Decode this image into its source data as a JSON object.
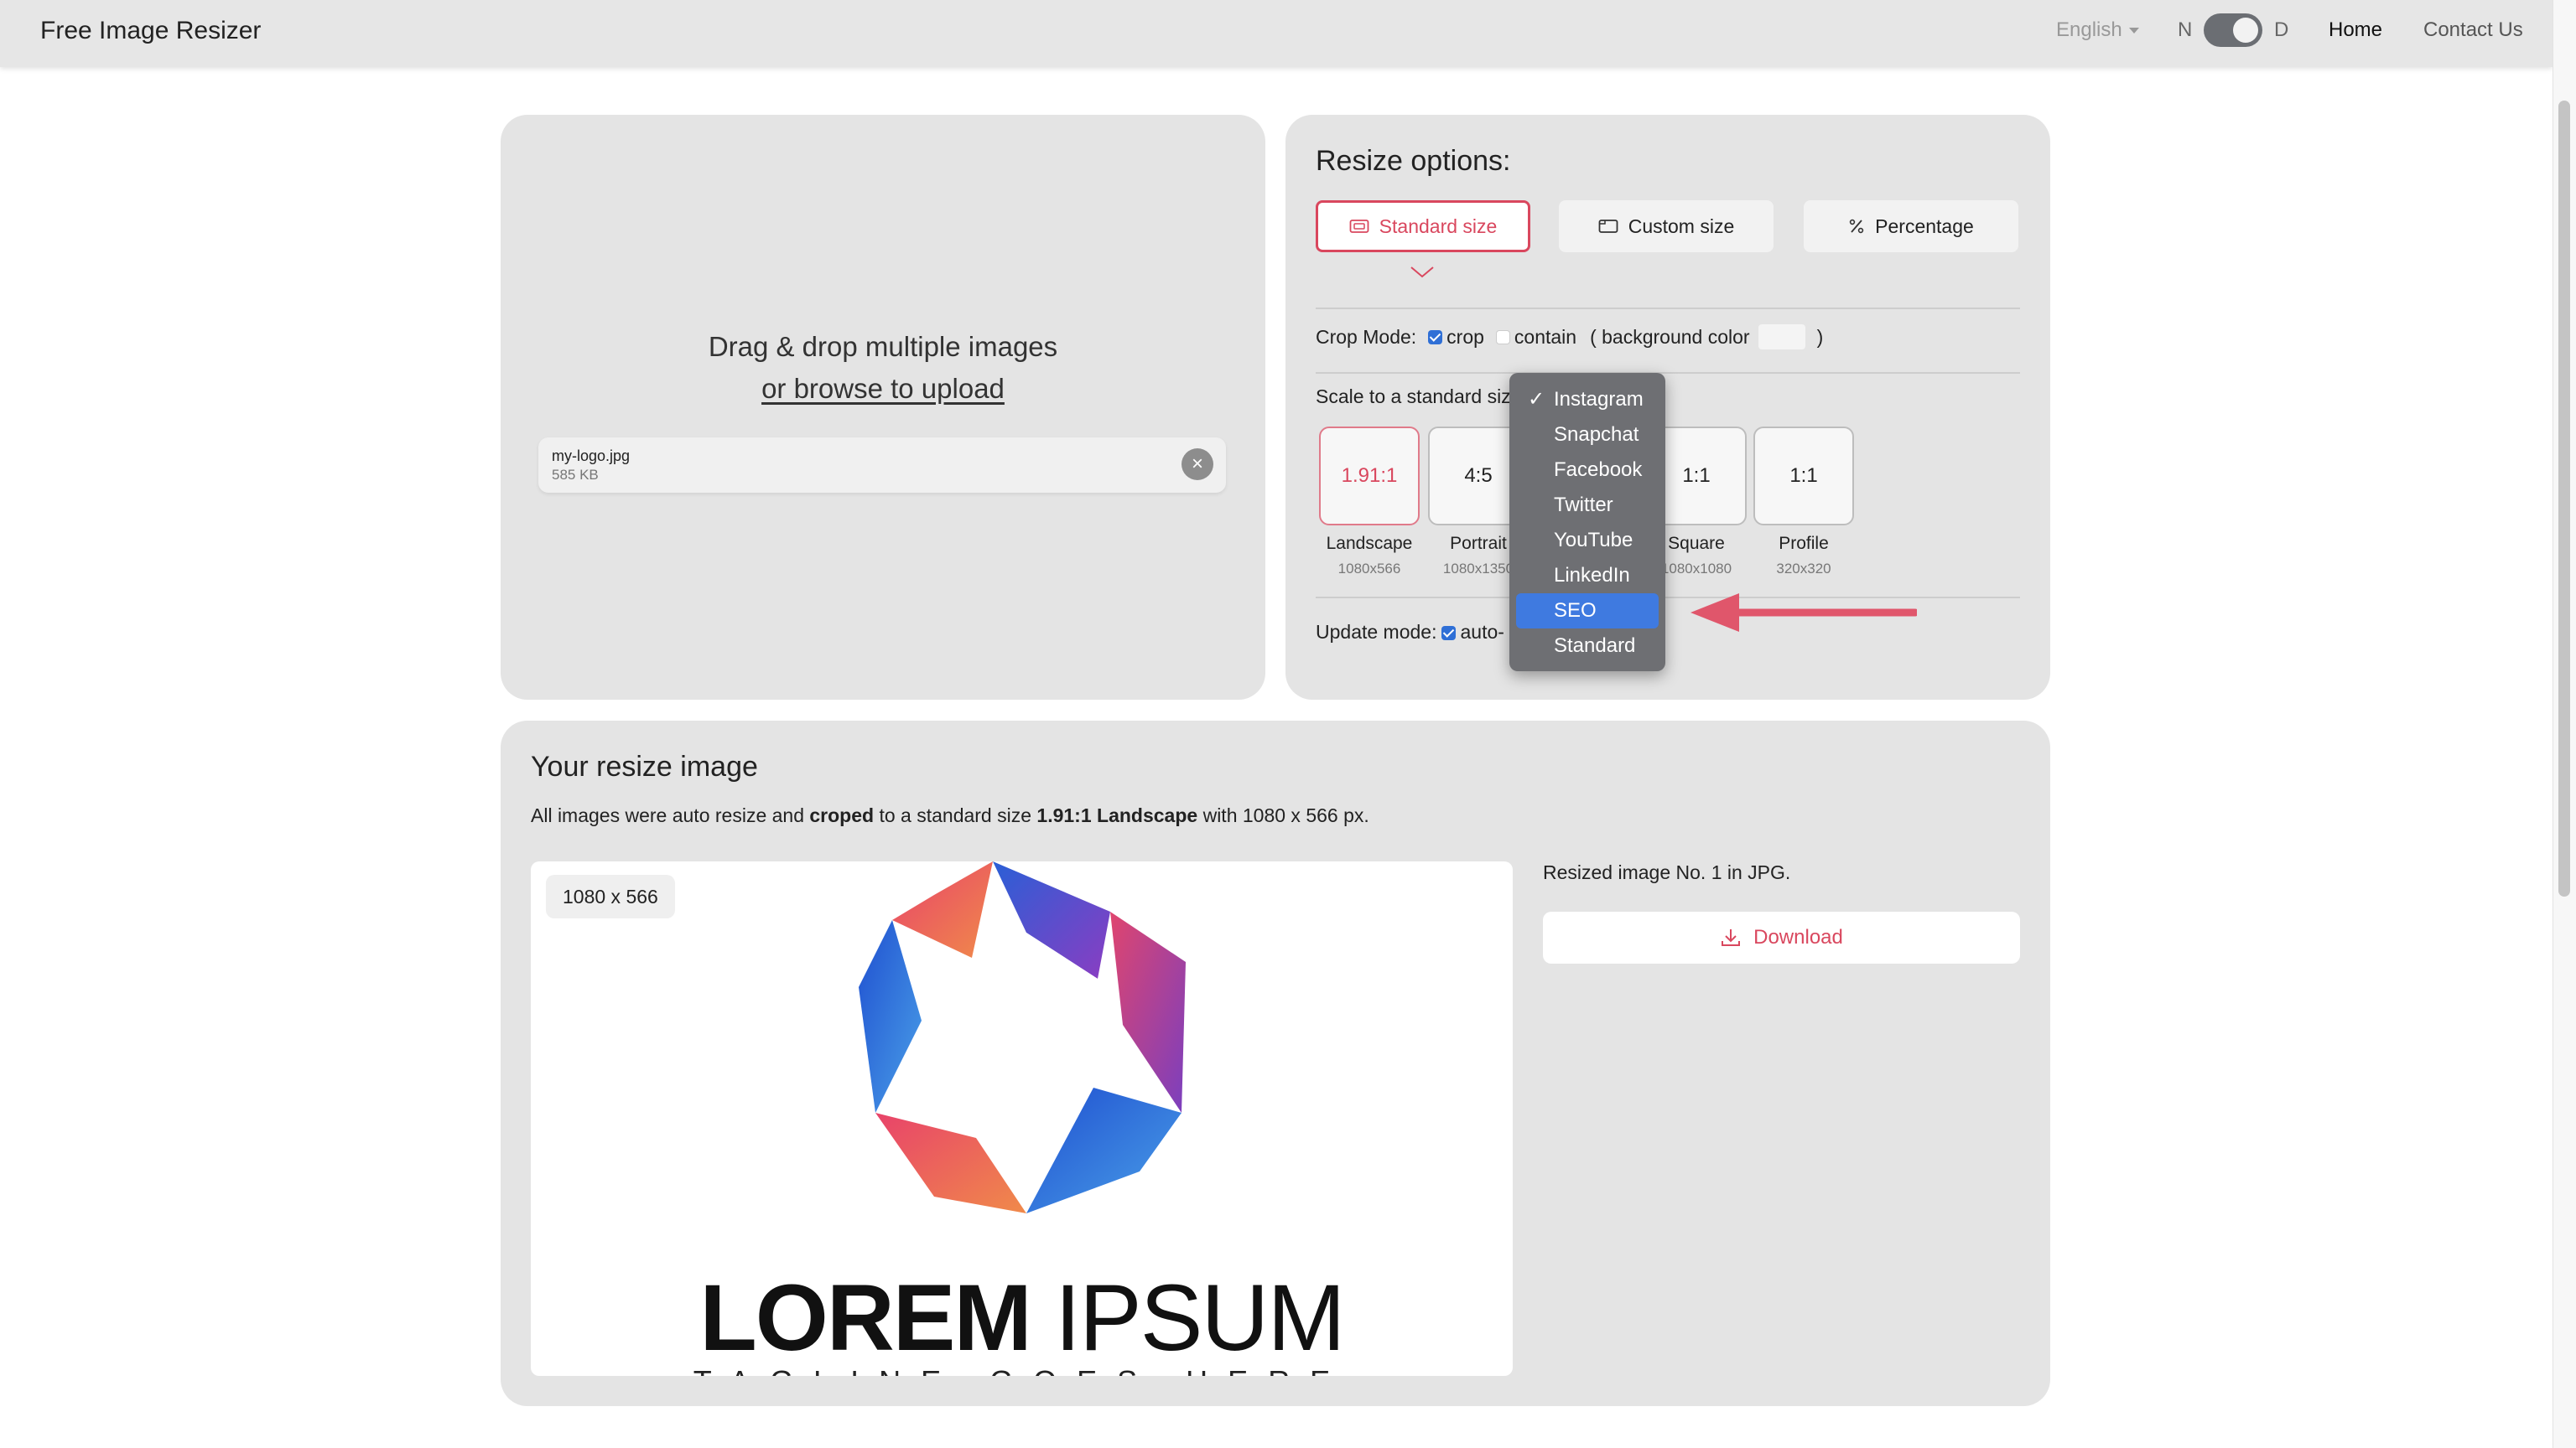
{
  "nav": {
    "brand": "Free Image Resizer",
    "language": "English",
    "mode_left": "N",
    "mode_right": "D",
    "home": "Home",
    "contact": "Contact Us"
  },
  "upload": {
    "line1": "Drag & drop multiple images",
    "line2": "or browse to upload",
    "file": {
      "name": "my-logo.jpg",
      "size": "585 KB",
      "remove": "×"
    }
  },
  "options": {
    "title": "Resize options:",
    "tabs": [
      {
        "label": "Standard size",
        "active": true
      },
      {
        "label": "Custom size",
        "active": false
      },
      {
        "label": "Percentage",
        "active": false
      }
    ],
    "crop_mode": {
      "label": "Crop Mode:",
      "crop": "crop",
      "contain": "contain",
      "bg_open": "( background color",
      "bg_close": ")",
      "crop_checked": true,
      "contain_checked": false
    },
    "scale_label": "Scale to a standard siz",
    "sizes": [
      {
        "ratio": "1.91:1",
        "label": "Landscape",
        "dim": "1080x566",
        "active": true
      },
      {
        "ratio": "4:5",
        "label": "Portrait",
        "dim": "1080x1350",
        "active": false
      },
      {
        "ratio": "1:1",
        "label": "Square",
        "dim": "1080x1080",
        "active": false
      },
      {
        "ratio": "1:1",
        "label": "Profile",
        "dim": "320x320",
        "active": false
      }
    ],
    "update_mode": {
      "label": "Update mode:",
      "value": "auto-",
      "checked": true
    }
  },
  "dropdown": {
    "items": [
      "Instagram",
      "Snapchat",
      "Facebook",
      "Twitter",
      "YouTube",
      "LinkedIn",
      "SEO",
      "Standard"
    ],
    "checked": "Instagram",
    "highlighted": "SEO"
  },
  "result": {
    "title": "Your resize image",
    "desc": {
      "part1": "All images were auto resize and ",
      "bold1": "croped",
      "part2": " to a standard size ",
      "bold2": "1.91:1 Landscape",
      "part3": " with 1080 x 566 px."
    },
    "badge": "1080 x 566",
    "logo_text_bold": "LOREM",
    "logo_text_light": "IPSUM",
    "tagline": "TAGLINE GOES HERE",
    "info": "Resized image No. 1 in JPG.",
    "download": "Download"
  },
  "colors": {
    "accent": "#d9475e",
    "panel": "#e4e4e4",
    "dropdown": "#6e6f73",
    "highlight": "#3f7ae0",
    "checkbox": "#2f6fd6"
  }
}
